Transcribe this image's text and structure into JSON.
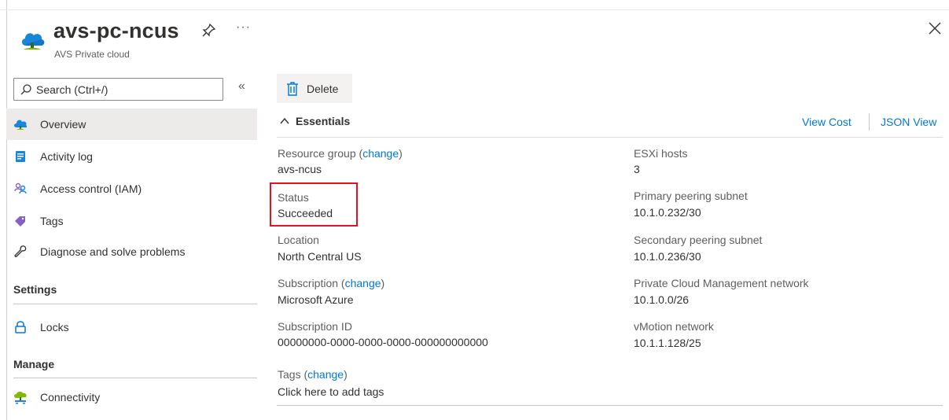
{
  "header": {
    "title": "avs-pc-ncus",
    "subtitle": "AVS Private cloud",
    "more": "···"
  },
  "search": {
    "placeholder": "Search (Ctrl+/)",
    "collapse": "«"
  },
  "nav": {
    "overview": "Overview",
    "activity_log": "Activity log",
    "iam": "Access control (IAM)",
    "tags": "Tags",
    "diagnose": "Diagnose and solve problems",
    "settings_heading": "Settings",
    "locks": "Locks",
    "manage_heading": "Manage",
    "connectivity": "Connectivity"
  },
  "toolbar": {
    "delete": "Delete"
  },
  "essentials": {
    "label": "Essentials",
    "view_cost": "View Cost",
    "json_view": "JSON View",
    "left": {
      "resource_group_label": "Resource group",
      "change": "change",
      "resource_group_value": "avs-ncus",
      "status_label": "Status",
      "status_value": "Succeeded",
      "location_label": "Location",
      "location_value": "North Central US",
      "subscription_label": "Subscription",
      "subscription_value": "Microsoft Azure",
      "subscription_id_label": "Subscription ID",
      "subscription_id_value": "00000000-0000-0000-0000-000000000000",
      "tags_label": "Tags",
      "tags_value": "Click here to add tags"
    },
    "right": {
      "esxi_label": "ESXi hosts",
      "esxi_value": "3",
      "primary_label": "Primary peering subnet",
      "primary_value": "10.1.0.232/30",
      "secondary_label": "Secondary peering subnet",
      "secondary_value": "10.1.0.236/30",
      "mgmt_label": "Private Cloud Management network",
      "mgmt_value": "10.1.0.0/26",
      "vmotion_label": "vMotion network",
      "vmotion_value": "10.1.1.128/25"
    }
  },
  "colors": {
    "accent": "#0078d4",
    "highlight": "#e81123",
    "selected": "#edebe9"
  }
}
